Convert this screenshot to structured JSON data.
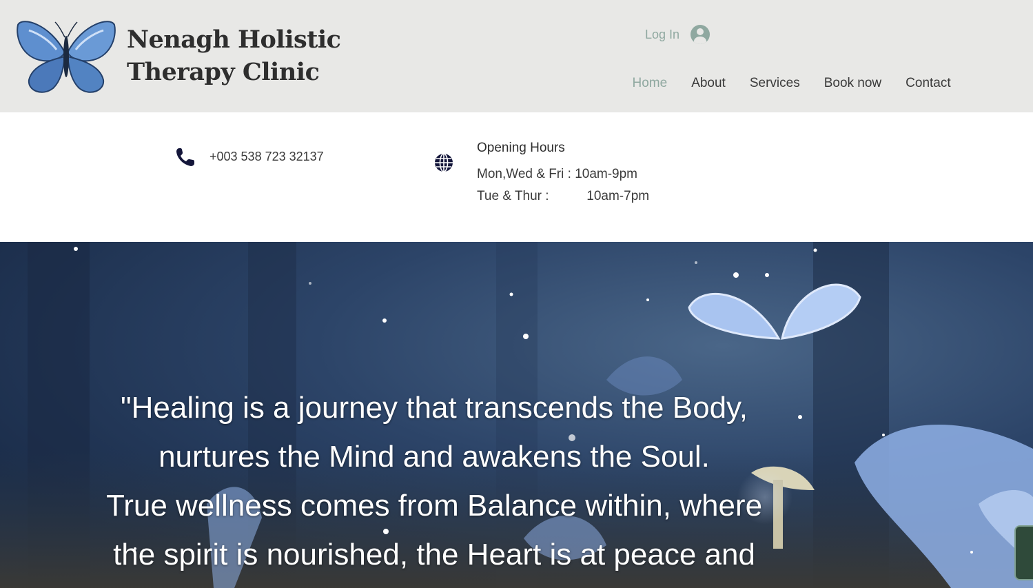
{
  "site": {
    "title_line1": "Nenagh Holistic",
    "title_line2": "Therapy Clinic",
    "logo_icon": "butterfly-logo"
  },
  "auth": {
    "login_label": "Log In",
    "avatar_icon": "user-avatar-icon"
  },
  "nav": {
    "items": [
      {
        "label": "Home",
        "active": true
      },
      {
        "label": "About",
        "active": false
      },
      {
        "label": "Services",
        "active": false
      },
      {
        "label": "Book now",
        "active": false
      },
      {
        "label": "Contact",
        "active": false
      }
    ]
  },
  "contact": {
    "phone_icon": "phone-icon",
    "phone": "+003 538 723 32137",
    "globe_icon": "globe-icon",
    "hours_title": "Opening Hours",
    "hours": [
      {
        "days": "Mon,Wed & Fri :",
        "time": "10am-9pm"
      },
      {
        "days": "Tue & Thur :",
        "time": "10am-7pm"
      }
    ]
  },
  "hero": {
    "quote_lines": [
      "\"Healing is a journey that transcends the Body,",
      "nurtures the Mind and awakens the Soul.",
      "True wellness comes from Balance within, where",
      "the spirit is nourished, the Heart is at peace and"
    ]
  },
  "colors": {
    "header_bg": "#e8e8e6",
    "accent": "#8fa8a0",
    "text": "#3a3a3a",
    "hero_blue": "#2c4468",
    "butterfly_blue": "#a9c4f0"
  }
}
